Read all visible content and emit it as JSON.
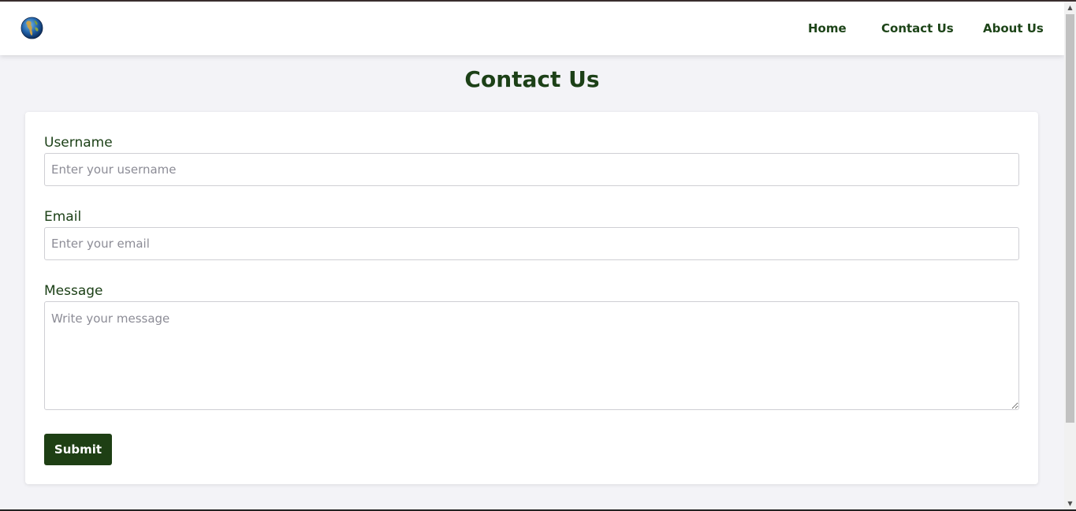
{
  "nav": {
    "logo_icon": "globe-icon",
    "links": [
      "Home",
      "Contact Us",
      "About Us"
    ]
  },
  "page": {
    "title": "Contact Us"
  },
  "form": {
    "username": {
      "label": "Username",
      "placeholder": "Enter your username",
      "value": ""
    },
    "email": {
      "label": "Email",
      "placeholder": "Enter your email",
      "value": ""
    },
    "message": {
      "label": "Message",
      "placeholder": "Write your message",
      "value": ""
    },
    "submit_label": "Submit"
  },
  "colors": {
    "brand_green": "#1e3f14",
    "text_green": "#1c4017",
    "page_bg": "#f3f3f7"
  }
}
